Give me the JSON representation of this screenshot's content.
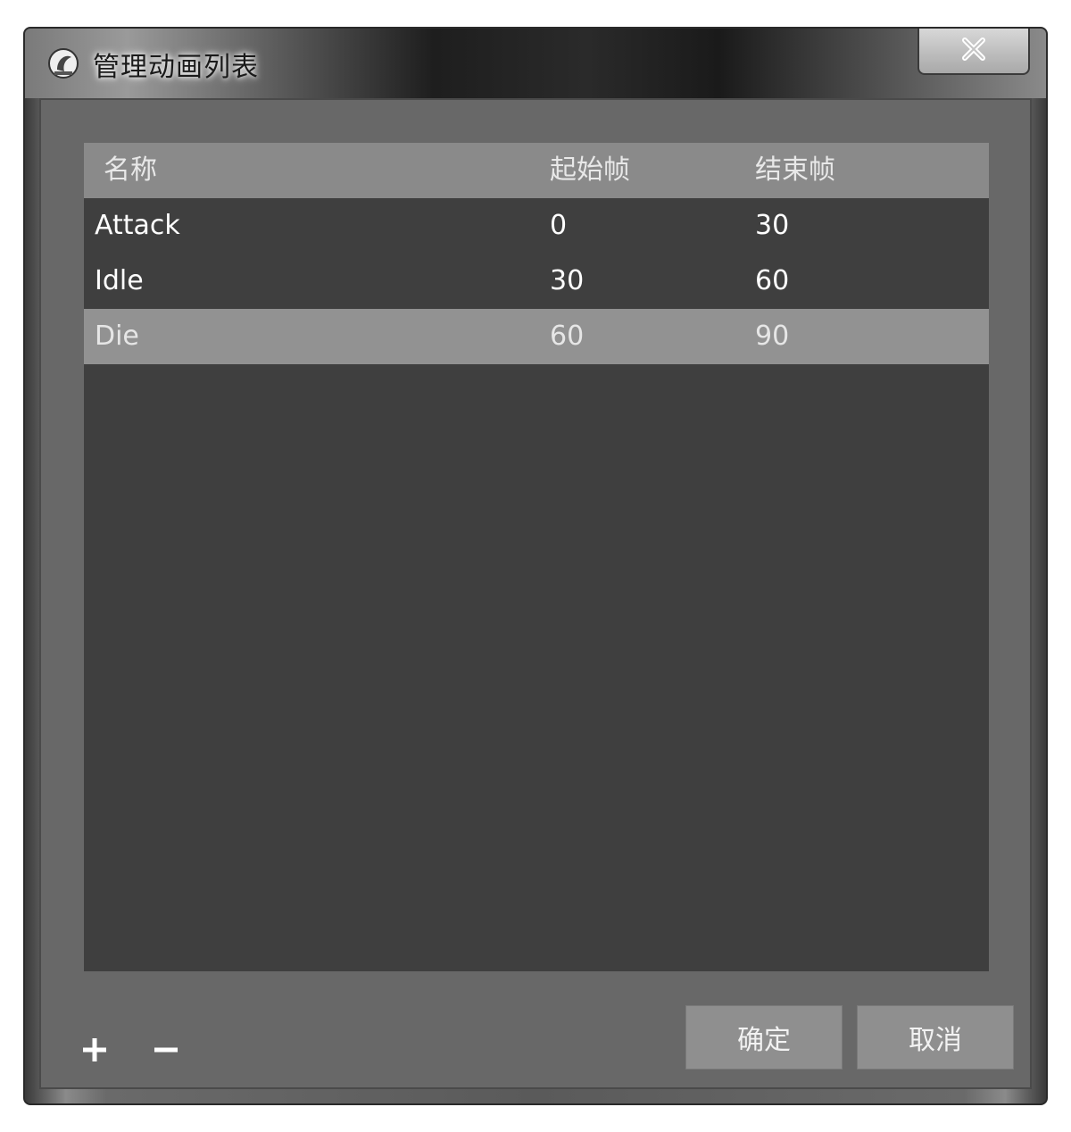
{
  "window": {
    "title": "管理动画列表",
    "app_icon": "app-logo-icon",
    "close_icon": "close-icon"
  },
  "table": {
    "headers": {
      "name": "名称",
      "start_frame": "起始帧",
      "end_frame": "结束帧"
    },
    "rows": [
      {
        "name": "Attack",
        "start": "0",
        "end": "30",
        "selected": false
      },
      {
        "name": "Idle",
        "start": "30",
        "end": "60",
        "selected": false
      },
      {
        "name": "Die",
        "start": "60",
        "end": "90",
        "selected": true
      }
    ]
  },
  "toolbar": {
    "add_icon": "plus-icon",
    "remove_icon": "minus-icon",
    "ok_label": "确定",
    "cancel_label": "取消"
  },
  "colors": {
    "list_background": "#3f3f3f",
    "header_background": "#8a8a8a",
    "selected_row": "#929292",
    "client_background": "#686868",
    "button_background": "#8f8f8f"
  }
}
